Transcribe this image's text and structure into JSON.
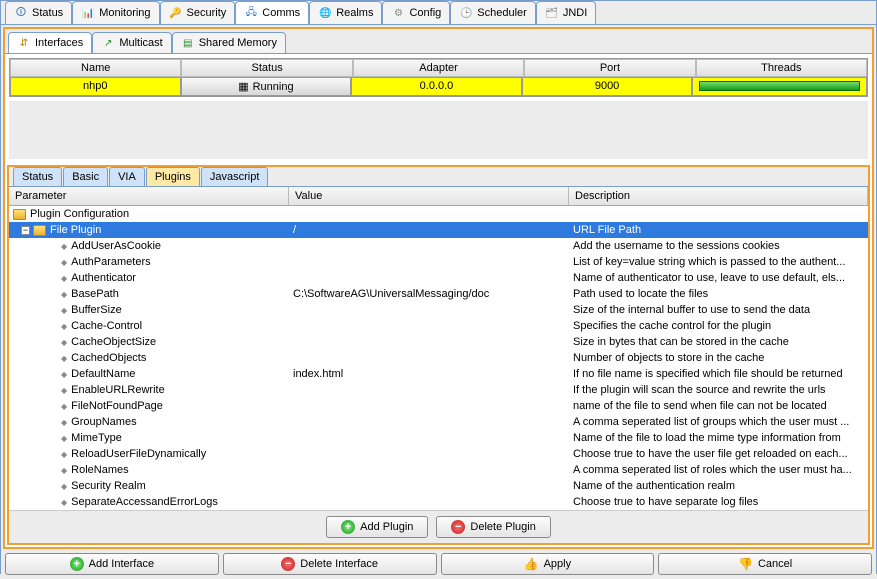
{
  "topTabs": [
    {
      "label": "Status",
      "icon": "🛈",
      "color": "#2a70c8"
    },
    {
      "label": "Monitoring",
      "icon": "📊",
      "color": "#2a8a2a"
    },
    {
      "label": "Security",
      "icon": "🔑",
      "color": "#d8a000"
    },
    {
      "label": "Comms",
      "icon": "🖧",
      "color": "#2a70c8",
      "active": true
    },
    {
      "label": "Realms",
      "icon": "🌐",
      "color": "#2a8a2a"
    },
    {
      "label": "Config",
      "icon": "⚙",
      "color": "#888"
    },
    {
      "label": "Scheduler",
      "icon": "🕒",
      "color": "#2a70c8"
    },
    {
      "label": "JNDI",
      "icon": "🗂",
      "color": "#888"
    }
  ],
  "subTabs": [
    {
      "label": "Interfaces",
      "icon": "⇵",
      "active": true,
      "color": "#d08000"
    },
    {
      "label": "Multicast",
      "icon": "↗",
      "color": "#2a8a2a"
    },
    {
      "label": "Shared Memory",
      "icon": "▤",
      "color": "#2a8a2a"
    }
  ],
  "ifaceTable": {
    "headers": [
      "Name",
      "Status",
      "Adapter",
      "Port",
      "Threads"
    ],
    "row": {
      "name": "nhp0",
      "status": "Running",
      "adapter": "0.0.0.0",
      "port": "9000"
    }
  },
  "detailTabs": [
    "Status",
    "Basic",
    "VIA",
    "Plugins",
    "Javascript"
  ],
  "detailActive": "Plugins",
  "pluginHeaders": {
    "param": "Parameter",
    "value": "Value",
    "desc": "Description"
  },
  "treeRootLabel": "Plugin Configuration",
  "filePluginLabel": "File Plugin",
  "filePluginValue": "/",
  "filePluginDesc": "URL File Path",
  "params": [
    {
      "name": "AddUserAsCookie",
      "value": "",
      "desc": "Add the username to the sessions cookies"
    },
    {
      "name": "AuthParameters",
      "value": "",
      "desc": "List of key=value string which is passed to the authent..."
    },
    {
      "name": "Authenticator",
      "value": "",
      "desc": "Name of authenticator to use, leave to use default, els..."
    },
    {
      "name": "BasePath",
      "value": "C:\\SoftwareAG\\UniversalMessaging/doc",
      "desc": "Path used to locate the files"
    },
    {
      "name": "BufferSize",
      "value": "",
      "desc": "Size of the internal buffer to use to send the data"
    },
    {
      "name": "Cache-Control",
      "value": "",
      "desc": "Specifies the cache control for the plugin"
    },
    {
      "name": "CacheObjectSize",
      "value": "",
      "desc": "Size in bytes that can be stored in the cache"
    },
    {
      "name": "CachedObjects",
      "value": "",
      "desc": "Number of objects to store in the cache"
    },
    {
      "name": "DefaultName",
      "value": "index.html",
      "desc": "If no file name is specified which file should be returned"
    },
    {
      "name": "EnableURLRewrite",
      "value": "",
      "desc": "If the plugin will scan the source and rewrite the urls"
    },
    {
      "name": "FileNotFoundPage",
      "value": "",
      "desc": "name of the file to send when file can not be located"
    },
    {
      "name": "GroupNames",
      "value": "",
      "desc": "A comma seperated list of groups which the user must ..."
    },
    {
      "name": "MimeType",
      "value": "",
      "desc": "Name of the file to load the mime type information from"
    },
    {
      "name": "ReloadUserFileDynamically",
      "value": "",
      "desc": "Choose true to have the user file get reloaded on each..."
    },
    {
      "name": "RoleNames",
      "value": "",
      "desc": "A comma seperated list of roles which the user must ha..."
    },
    {
      "name": "Security Realm",
      "value": "",
      "desc": "Name of the authentication realm"
    },
    {
      "name": "SeparateAccessandErrorLogs",
      "value": "",
      "desc": "Choose true to have separate log files"
    }
  ],
  "pluginBtns": {
    "add": "Add Plugin",
    "del": "Delete Plugin"
  },
  "bottomBtns": {
    "addIf": "Add Interface",
    "delIf": "Delete Interface",
    "apply": "Apply",
    "cancel": "Cancel"
  }
}
